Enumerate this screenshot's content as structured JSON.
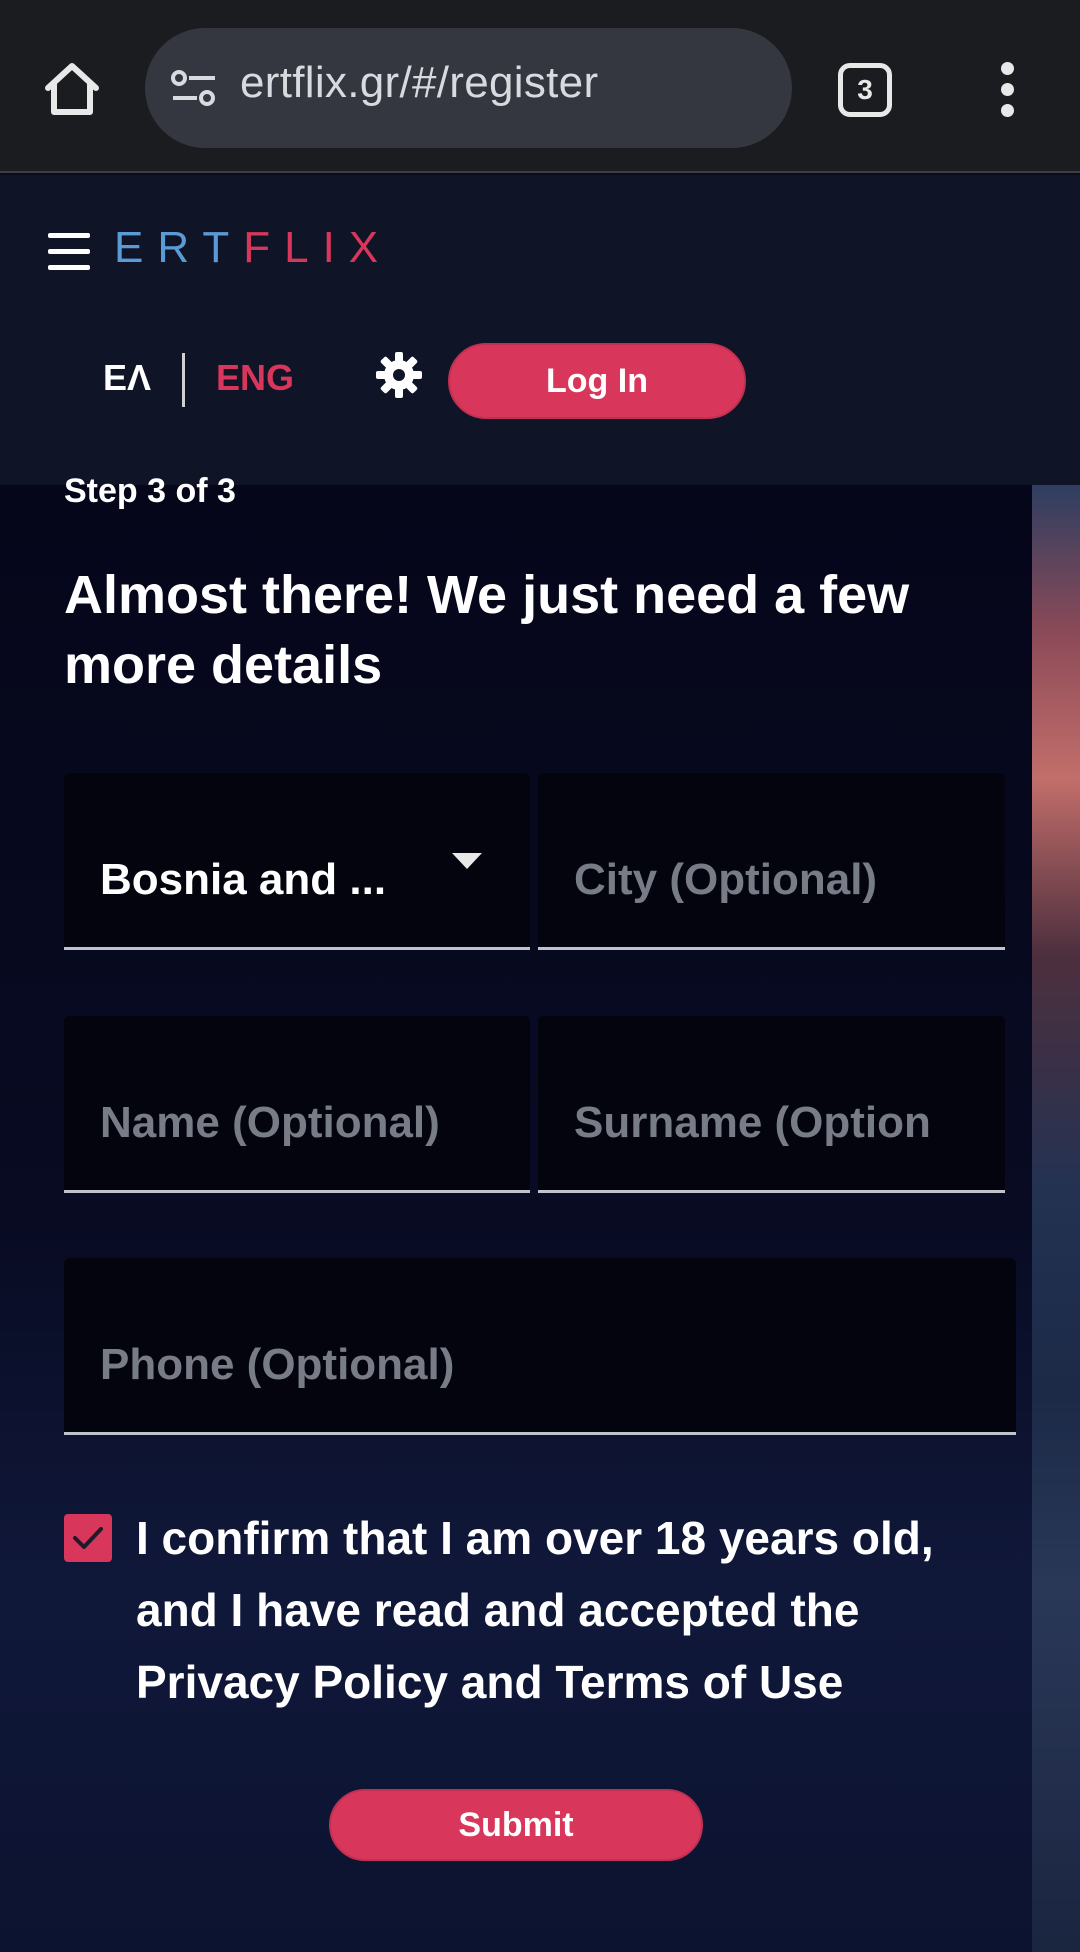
{
  "browser": {
    "url": "ertflix.gr/#/register",
    "tab_count": "3"
  },
  "header": {
    "logo_left": "ERT",
    "logo_right": "FLIX",
    "lang_el": "ΕΛ",
    "lang_en": "ENG",
    "login_label": "Log In"
  },
  "form": {
    "step": "Step 3 of 3",
    "heading": "Almost there! We just need a few more details",
    "country_value": "Bosnia and ...",
    "city_placeholder": "City (Optional)",
    "name_placeholder": "Name (Optional)",
    "surname_placeholder": "Surname (Option",
    "phone_placeholder": "Phone (Optional)",
    "confirm_text": "I confirm that I am over 18 years old, and I have read and accepted the Privacy Policy and Terms of Use",
    "confirm_checked": true,
    "submit_label": "Submit"
  },
  "colors": {
    "accent": "#d9365b",
    "logo_blue": "#5b9bd5",
    "background": "#0a0c1c"
  }
}
